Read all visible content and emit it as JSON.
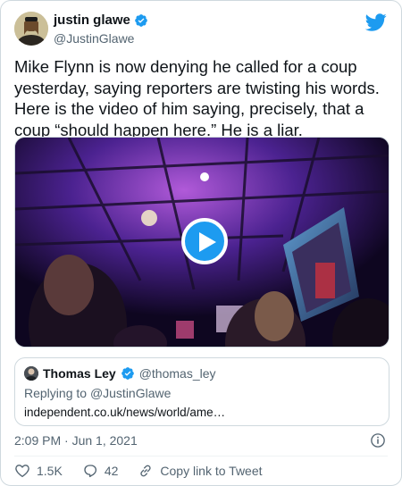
{
  "author": {
    "display_name": "justin glawe",
    "handle": "@JustinGlawe"
  },
  "tweet": {
    "text": "Mike Flynn is now denying he called for a coup yesterday, saying reporters are twisting his words. Here is the video of him saying, precisely, that a coup “should happen here.” He is a liar.",
    "timestamp": "2:09 PM · Jun 1, 2021"
  },
  "quoted": {
    "display_name": "Thomas Ley",
    "handle": "@thomas_ley",
    "replying_prefix": "Replying to ",
    "replying_to": "@JustinGlawe",
    "link_text": "independent.co.uk/news/world/ame…"
  },
  "actions": {
    "likes": "1.5K",
    "replies": "42",
    "copy_link": "Copy link to Tweet"
  },
  "colors": {
    "accent": "#1d9bf0",
    "like": "#f91880",
    "secondary_text": "#536471"
  },
  "icons": [
    "verified-badge-icon",
    "twitter-bird-icon",
    "play-icon",
    "info-icon",
    "heart-icon",
    "reply-icon",
    "link-icon"
  ]
}
